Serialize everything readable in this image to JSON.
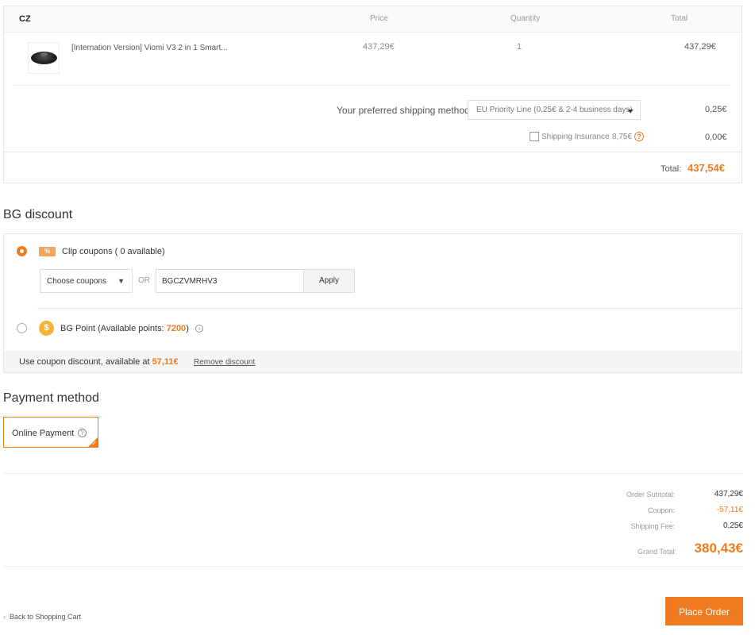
{
  "order": {
    "country": "CZ",
    "columns": {
      "price": "Price",
      "quantity": "Quantity",
      "total": "Total"
    },
    "product": {
      "name": "[Internation Version] Viomi V3 2 in 1 Smart...",
      "price": "437,29€",
      "quantity": "1",
      "total": "437,29€"
    },
    "shipping": {
      "label": "Your preferred shipping method:",
      "selected": "EU Priority Line (0,25€ & 2-4 business days)",
      "fee": "0,25€"
    },
    "insurance": {
      "label": "Shipping Insurance",
      "price": "8,75€",
      "fee": "0,00€",
      "checked": false
    },
    "total_label": "Total:",
    "total_value": "437,54€"
  },
  "discount": {
    "title": "BG discount",
    "clip_icon_text": "%",
    "clip_label": "Clip coupons ( 0 available)",
    "choose_label": "Choose coupons",
    "or_text": "OR",
    "code_value": "BGCZVMRHV3",
    "apply_label": "Apply",
    "coin_icon_text": "$",
    "point_prefix": "BG Point (Available points: ",
    "point_value": "7200",
    "point_suffix": ")",
    "use_text": "Use coupon discount, available at ",
    "use_amount": "57,11€",
    "remove_label": "Remove discount"
  },
  "payment": {
    "title": "Payment method",
    "option_label": "Online Payment"
  },
  "summary": {
    "subtotal_label": "Order Subtotal:",
    "subtotal_value": "437,29€",
    "coupon_label": "Coupon:",
    "coupon_value": "-57,11€",
    "shipping_label": "Shipping Fee:",
    "shipping_value": "0,25€",
    "grand_label": "Grand Total:",
    "grand_value": "380,43€"
  },
  "footer": {
    "back_label": "Back to Shopping Cart",
    "place_label": "Place Order"
  },
  "colors": {
    "accent": "#f07a1f",
    "coin": "#f8b335"
  },
  "icons": [
    "question-icon",
    "info-icon",
    "coupon-icon",
    "coin-icon",
    "chevron-left-icon",
    "caret-down-icon",
    "check-icon"
  ]
}
